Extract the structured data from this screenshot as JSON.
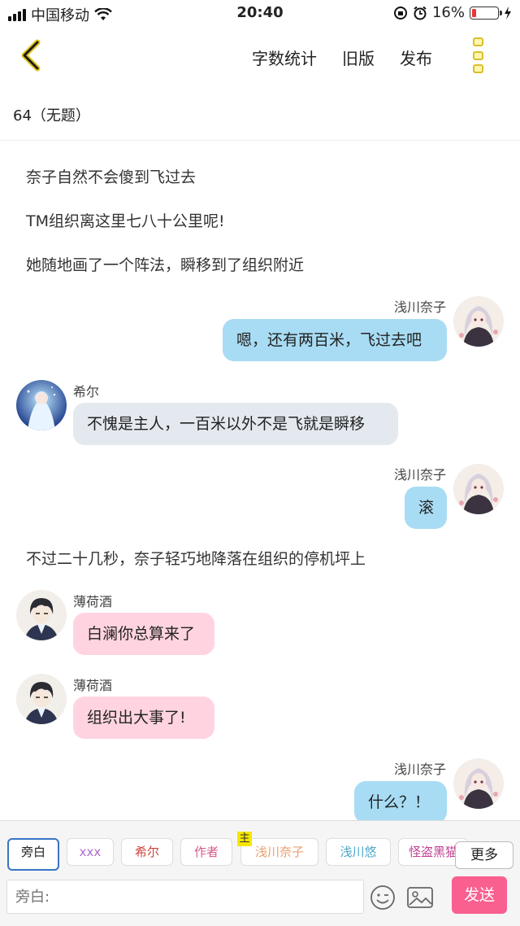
{
  "status_bar": {
    "carrier": "中国移动",
    "time": "20:40",
    "battery": "16%",
    "battery_level": 0.16
  },
  "nav": {
    "word_count": "字数统计",
    "old_version": "旧版",
    "publish": "发布"
  },
  "doc_title": "64（无题）",
  "messages": [
    {
      "type": "narration",
      "text": "奈子自然不会傻到飞过去"
    },
    {
      "type": "narration",
      "text": "TM组织离这里七八十公里呢!"
    },
    {
      "type": "narration",
      "text": "她随地画了一个阵法，瞬移到了组织附近"
    },
    {
      "type": "right",
      "name": "浅川奈子",
      "text": "嗯，还有两百米，飞过去吧"
    },
    {
      "type": "left",
      "name": "希尔",
      "text": "不愧是主人，一百米以外不是飞就是瞬移"
    },
    {
      "type": "right",
      "name": "浅川奈子",
      "text": "滚"
    },
    {
      "type": "narration",
      "text": "不过二十几秒，奈子轻巧地降落在组织的停机坪上"
    },
    {
      "type": "left",
      "name": "薄荷酒",
      "text": "白澜你总算来了"
    },
    {
      "type": "left",
      "name": "薄荷酒",
      "text": "组织出大事了!"
    },
    {
      "type": "right",
      "name": "浅川奈子",
      "text": "什么？！"
    }
  ],
  "roles": [
    {
      "label": "旁白",
      "color": "#222222",
      "selected": true
    },
    {
      "label": "xxx",
      "color": "#b06ad0"
    },
    {
      "label": "希尔",
      "color": "#d0443c"
    },
    {
      "label": "作者",
      "color": "#d85a8a"
    },
    {
      "label": "浅川奈子",
      "color": "#e8a070",
      "badge": "主"
    },
    {
      "label": "浅川悠",
      "color": "#4aa8c8"
    },
    {
      "label": "怪盗黑猫",
      "color": "#c04090"
    }
  ],
  "more_label": "更多",
  "input_placeholder": "旁白:",
  "send_label": "发送"
}
